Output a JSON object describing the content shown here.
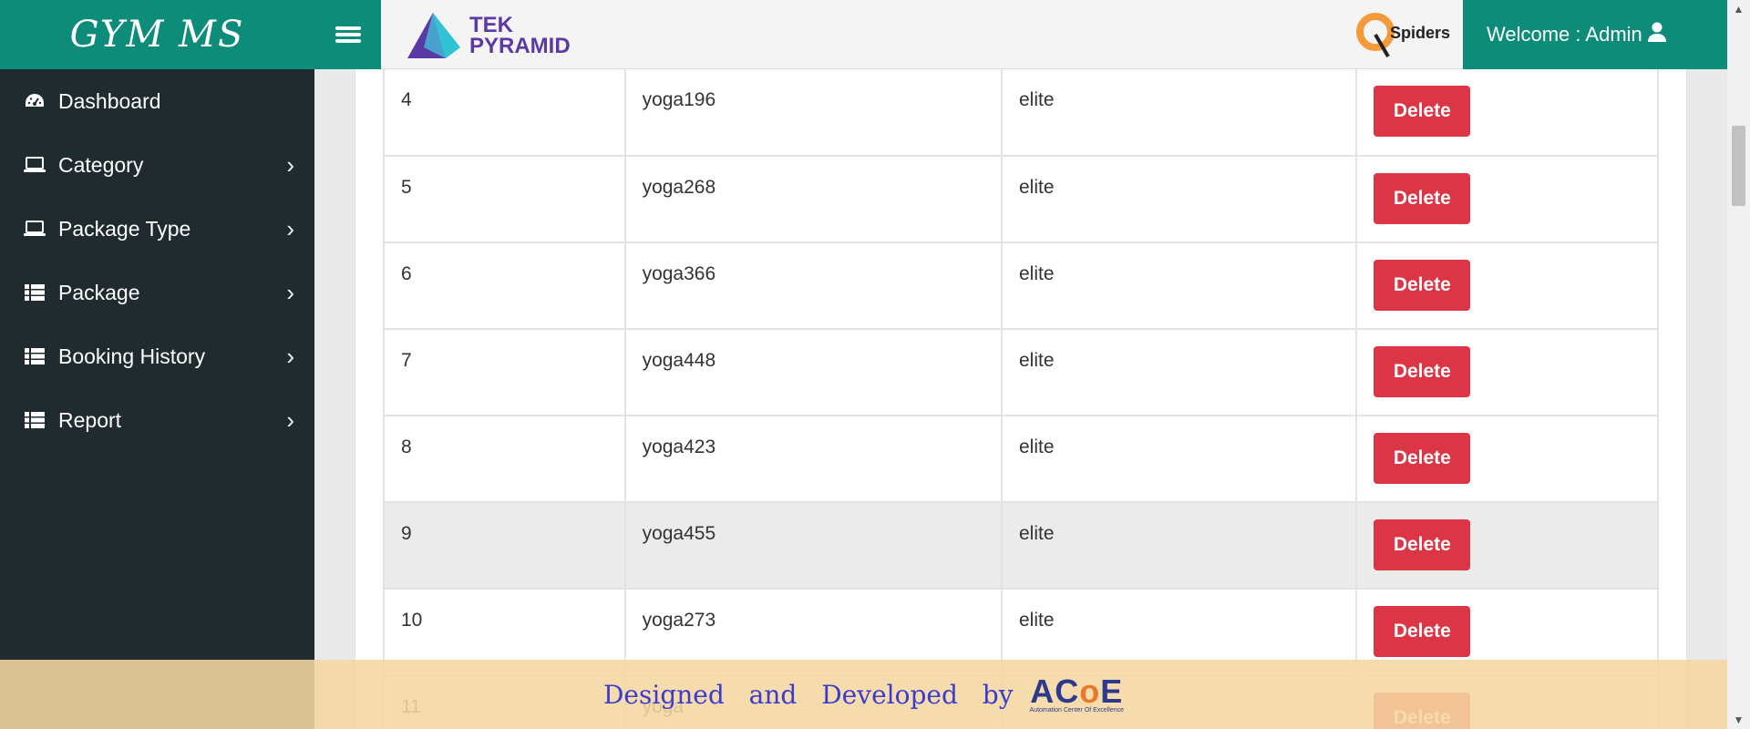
{
  "brand": {
    "title": "GYM MS"
  },
  "sidebar": {
    "items": [
      {
        "label": "Dashboard",
        "icon": "dashboard-icon",
        "has_chevron": false
      },
      {
        "label": "Category",
        "icon": "laptop-icon",
        "has_chevron": true
      },
      {
        "label": "Package Type",
        "icon": "laptop-icon",
        "has_chevron": true
      },
      {
        "label": "Package",
        "icon": "list-icon",
        "has_chevron": true
      },
      {
        "label": "Booking History",
        "icon": "list-icon",
        "has_chevron": true
      },
      {
        "label": "Report",
        "icon": "list-icon",
        "has_chevron": true
      }
    ],
    "chevron": "›"
  },
  "header": {
    "tek_line1": "TEK",
    "tek_line2": "PYRAMID",
    "qspiders_text": "Spiders",
    "welcome": "Welcome : Admin"
  },
  "table": {
    "delete_label": "Delete",
    "rows": [
      {
        "id": "4",
        "name": "yoga196",
        "type": "elite"
      },
      {
        "id": "5",
        "name": "yoga268",
        "type": "elite"
      },
      {
        "id": "6",
        "name": "yoga366",
        "type": "elite"
      },
      {
        "id": "7",
        "name": "yoga448",
        "type": "elite"
      },
      {
        "id": "8",
        "name": "yoga423",
        "type": "elite"
      },
      {
        "id": "9",
        "name": "yoga455",
        "type": "elite",
        "highlighted": true
      },
      {
        "id": "10",
        "name": "yoga273",
        "type": "elite"
      },
      {
        "id": "11",
        "name": "yoga",
        "type": ""
      }
    ]
  },
  "footer": {
    "text": "Designed and Developed by",
    "logo_text_a": "AC",
    "logo_text_o": "o",
    "logo_text_e": "E",
    "logo_sub": "Automation Center Of Excellence"
  },
  "colors": {
    "brand": "#0e8c7a",
    "sidebar": "#202b30",
    "delete": "#dc3545",
    "footer": "#f5d7a0"
  }
}
